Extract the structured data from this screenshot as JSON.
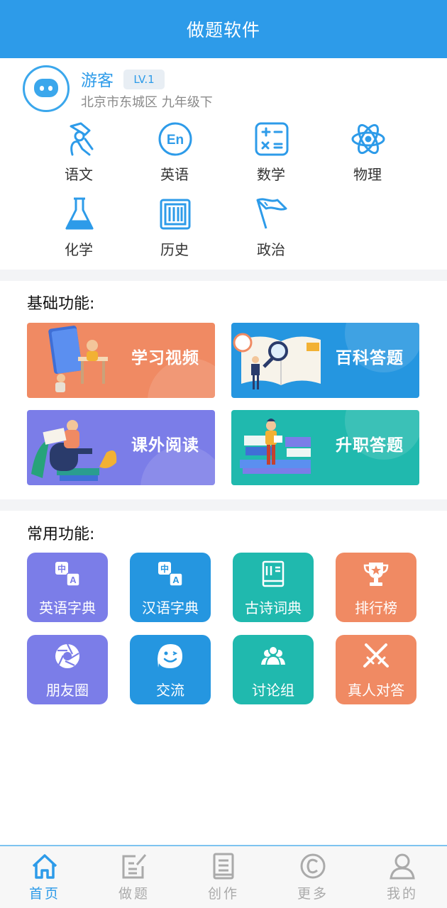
{
  "header": {
    "title": "做题软件"
  },
  "user": {
    "name": "游客",
    "level": "LV.1",
    "location": "北京市东城区 九年级下"
  },
  "subjects": [
    {
      "label": "语文",
      "icon": "chinese-icon"
    },
    {
      "label": "英语",
      "icon": "english-icon"
    },
    {
      "label": "数学",
      "icon": "math-icon"
    },
    {
      "label": "物理",
      "icon": "physics-icon"
    },
    {
      "label": "化学",
      "icon": "chemistry-icon"
    },
    {
      "label": "历史",
      "icon": "history-icon"
    },
    {
      "label": "政治",
      "icon": "politics-icon"
    }
  ],
  "basic": {
    "title": "基础功能:",
    "cards": [
      {
        "label": "学习视频",
        "color": "#f08a63"
      },
      {
        "label": "百科答题",
        "color": "#2596e0"
      },
      {
        "label": "课外阅读",
        "color": "#7b7de8"
      },
      {
        "label": "升职答题",
        "color": "#20b9ae"
      }
    ]
  },
  "common": {
    "title": "常用功能:",
    "tiles": [
      {
        "label": "英语字典",
        "icon": "translate-icon",
        "color": "#7b7de8"
      },
      {
        "label": "汉语字典",
        "icon": "translate-icon",
        "color": "#2596e0"
      },
      {
        "label": "古诗词典",
        "icon": "book-icon",
        "color": "#20b9ae"
      },
      {
        "label": "排行榜",
        "icon": "trophy-icon",
        "color": "#f08a63"
      },
      {
        "label": "朋友圈",
        "icon": "aperture-icon",
        "color": "#7b7de8"
      },
      {
        "label": "交流",
        "icon": "chat-icon",
        "color": "#2596e0"
      },
      {
        "label": "讨论组",
        "icon": "group-icon",
        "color": "#20b9ae"
      },
      {
        "label": "真人对答",
        "icon": "swords-icon",
        "color": "#f08a63"
      }
    ]
  },
  "nav": [
    {
      "label": "首页",
      "icon": "home-icon",
      "active": true
    },
    {
      "label": "做题",
      "icon": "edit-icon"
    },
    {
      "label": "创作",
      "icon": "document-icon"
    },
    {
      "label": "更多",
      "icon": "copyright-icon"
    },
    {
      "label": "我的",
      "icon": "user-icon"
    }
  ]
}
